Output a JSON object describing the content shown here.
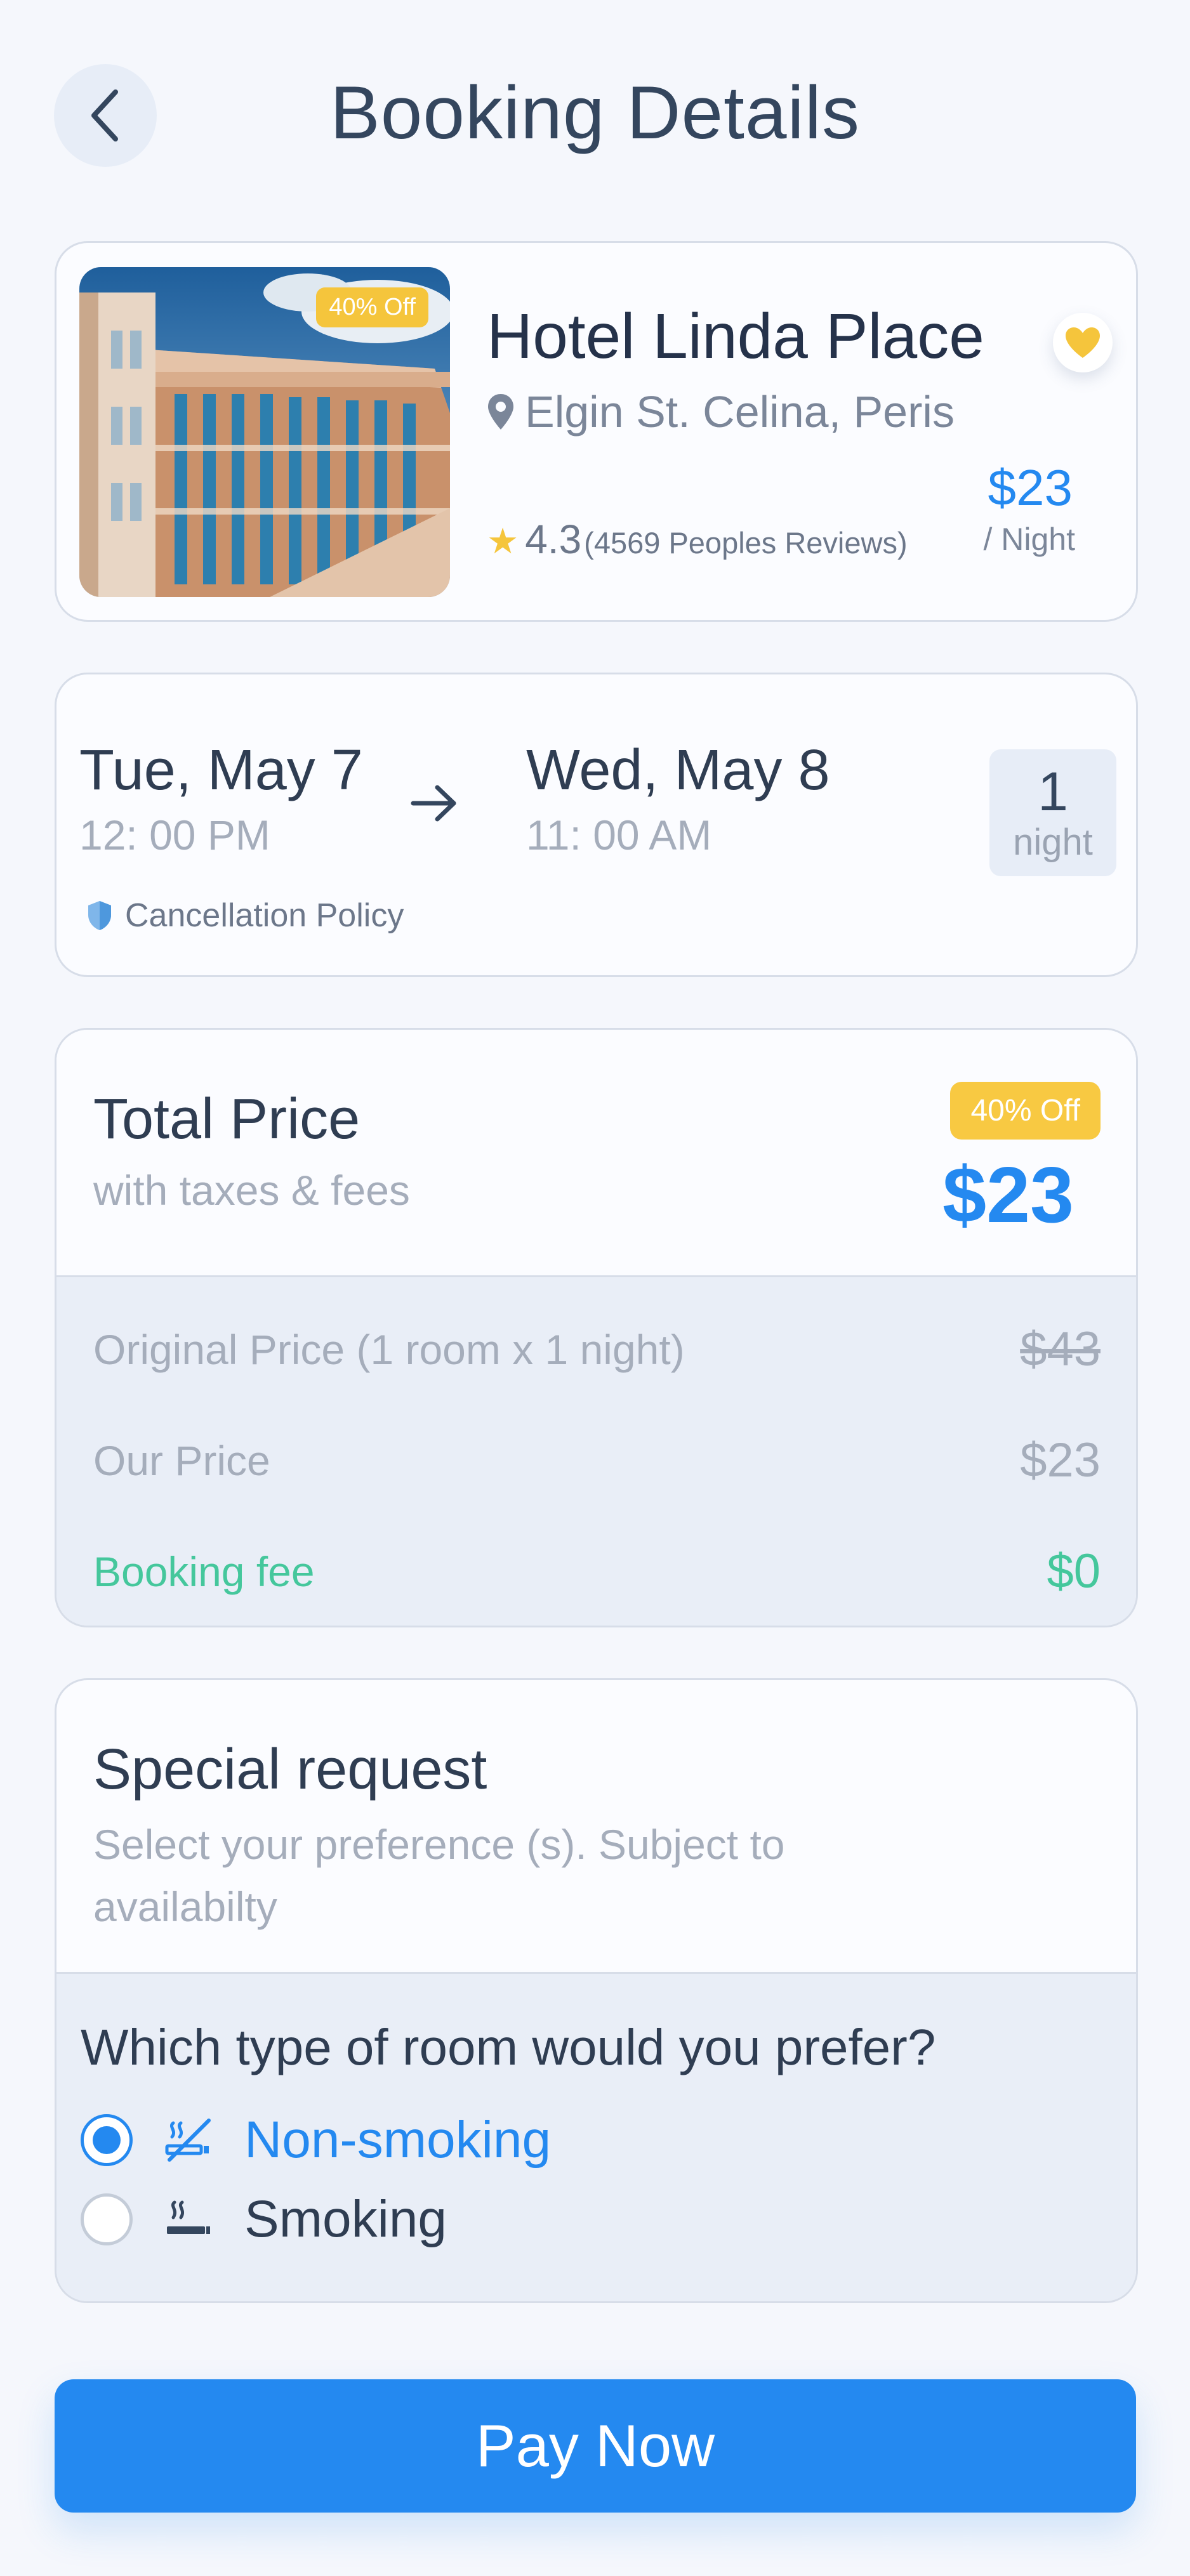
{
  "header": {
    "title": "Booking Details"
  },
  "hotel": {
    "discount_badge": "40% Off",
    "name": "Hotel Linda Place",
    "location": "Elgin St. Celina, Peris",
    "rating": "4.3",
    "reviews": "(4569 Peoples Reviews)",
    "price": "$23",
    "price_unit": "/ Night",
    "favorite": true
  },
  "dates": {
    "checkin_day": "Tue, May 7",
    "checkin_time": "12: 00 PM",
    "checkout_day": "Wed, May 8",
    "checkout_time": "11: 00 AM",
    "nights_count": "1",
    "nights_label": "night",
    "policy_label": "Cancellation Policy"
  },
  "price": {
    "title": "Total Price",
    "subtitle": "with taxes & fees",
    "discount_badge": "40% Off",
    "total": "$23",
    "rows": [
      {
        "label": "Original  Price (1 room x 1 night)",
        "value": "$43"
      },
      {
        "label": "Our Price",
        "value": "$23"
      },
      {
        "label": "Booking fee",
        "value": "$0"
      }
    ]
  },
  "request": {
    "title": "Special request",
    "subtitle": "Select your preference (s). Subject to availabilty",
    "question": "Which type of room would you prefer?",
    "options": [
      {
        "label": "Non-smoking",
        "selected": true,
        "icon": "no-smoking-icon"
      },
      {
        "label": "Smoking",
        "selected": false,
        "icon": "smoking-icon"
      }
    ]
  },
  "footer": {
    "pay_label": "Pay Now"
  },
  "colors": {
    "accent": "#2489f0",
    "badge": "#f5c53c",
    "fee_green": "#45c79c",
    "text_dark": "#2f3d52",
    "text_muted": "#a5adbb"
  }
}
